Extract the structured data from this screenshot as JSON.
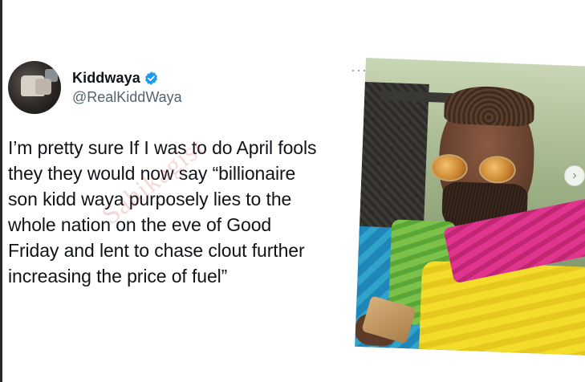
{
  "tweet": {
    "display_name": "Kiddwaya",
    "handle": "@RealKiddWaya",
    "verified": true,
    "more_label": "···",
    "text": "I’m pretty sure If I was to do April fools\nthey they would now say “billionaire\nson kidd waya purposely lies to the\nwhole nation on the eve of Good\nFriday and lent to chase clout further\nincreasing the price of fuel”"
  },
  "watermark": {
    "text": "Sahikagist"
  },
  "carousel": {
    "next_label": "›"
  },
  "colors": {
    "verified_badge": "#1d9bf0",
    "text_primary": "#0f1419",
    "text_secondary": "#536471"
  },
  "icons": {
    "verified": "verified-badge-icon",
    "more": "more-options-icon",
    "next": "chevron-right-icon"
  }
}
